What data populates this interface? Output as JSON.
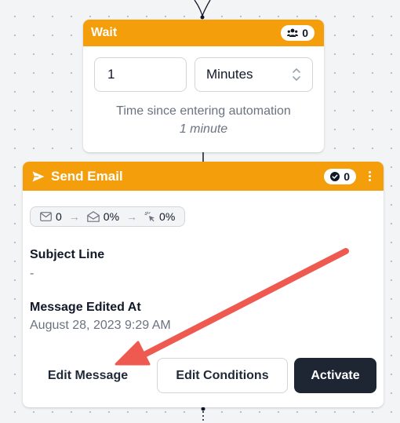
{
  "wait_step": {
    "title": "Wait",
    "contacts_count": "0",
    "amount": "1",
    "unit": "Minutes",
    "description": "Time since entering automation",
    "summary": "1 minute"
  },
  "email_step": {
    "title": "Send Email",
    "completed_count": "0",
    "stats": {
      "sent": "0",
      "opened": "0%",
      "clicked": "0%"
    },
    "subject_label": "Subject Line",
    "subject_value": "-",
    "edited_label": "Message Edited At",
    "edited_value": "August 28, 2023 9:29 AM",
    "buttons": {
      "edit_message": "Edit Message",
      "edit_conditions": "Edit Conditions",
      "activate": "Activate"
    }
  },
  "colors": {
    "header": "#f59e0b",
    "primary_button": "#1e2533",
    "annotation_arrow": "#ef5a50"
  },
  "icons": {
    "wait_badge": "users-icon",
    "email_title": "send-icon",
    "email_badge": "check-circle-icon",
    "menu": "more-vertical-icon",
    "unit_select": "chevron-up-down-icon",
    "stat_sent": "mail-icon",
    "stat_opened": "mail-open-icon",
    "stat_clicked": "pointer-click-icon"
  }
}
